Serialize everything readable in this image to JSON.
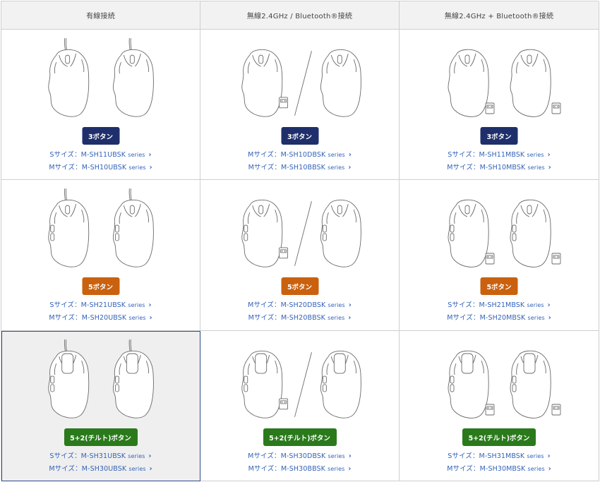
{
  "colors": {
    "btn3": "#1f2f6b",
    "btn5": "#c9610f",
    "btn7": "#2a7a1c",
    "link": "#3463b8"
  },
  "headers": [
    "有線接続",
    "無線2.4GHz / Bluetooth®接続",
    "無線2.4GHz + Bluetooth®接続"
  ],
  "rows": [
    {
      "button_label": "3ボタン",
      "cells": [
        {
          "links": [
            {
              "label": "Sサイズ：M-SH11UBSK",
              "series": "series"
            },
            {
              "label": "Mサイズ：M-SH10UBSK",
              "series": "series"
            }
          ]
        },
        {
          "links": [
            {
              "label": "Mサイズ：M-SH10DBSK",
              "series": "series"
            },
            {
              "label": "Mサイズ：M-SH10BBSK",
              "series": "series"
            }
          ]
        },
        {
          "links": [
            {
              "label": "Sサイズ：M-SH11MBSK",
              "series": "series"
            },
            {
              "label": "Mサイズ：M-SH10MBSK",
              "series": "series"
            }
          ]
        }
      ]
    },
    {
      "button_label": "5ボタン",
      "cells": [
        {
          "links": [
            {
              "label": "Sサイズ：M-SH21UBSK",
              "series": "series"
            },
            {
              "label": "Mサイズ：M-SH20UBSK",
              "series": "series"
            }
          ]
        },
        {
          "links": [
            {
              "label": "Mサイズ：M-SH20DBSK",
              "series": "series"
            },
            {
              "label": "Mサイズ：M-SH20BBSK",
              "series": "series"
            }
          ]
        },
        {
          "links": [
            {
              "label": "Sサイズ：M-SH21MBSK",
              "series": "series"
            },
            {
              "label": "Mサイズ：M-SH20MBSK",
              "series": "series"
            }
          ]
        }
      ]
    },
    {
      "button_label": "5+2(チルト)ボタン",
      "cells": [
        {
          "links": [
            {
              "label": "Sサイズ：M-SH31UBSK",
              "series": "series"
            },
            {
              "label": "Mサイズ：M-SH30UBSK",
              "series": "series"
            }
          ]
        },
        {
          "links": [
            {
              "label": "Mサイズ：M-SH30DBSK",
              "series": "series"
            },
            {
              "label": "Mサイズ：M-SH30BBSK",
              "series": "series"
            }
          ]
        },
        {
          "links": [
            {
              "label": "Sサイズ：M-SH31MBSK",
              "series": "series"
            },
            {
              "label": "Mサイズ：M-SH30MBSK",
              "series": "series"
            }
          ]
        }
      ]
    }
  ],
  "icons": {
    "chevron": "chevron-right-icon",
    "mouse": "mouse-icon",
    "dongle": "usb-receiver-icon",
    "cable": "cable-icon",
    "divider": "slash-divider-icon"
  }
}
